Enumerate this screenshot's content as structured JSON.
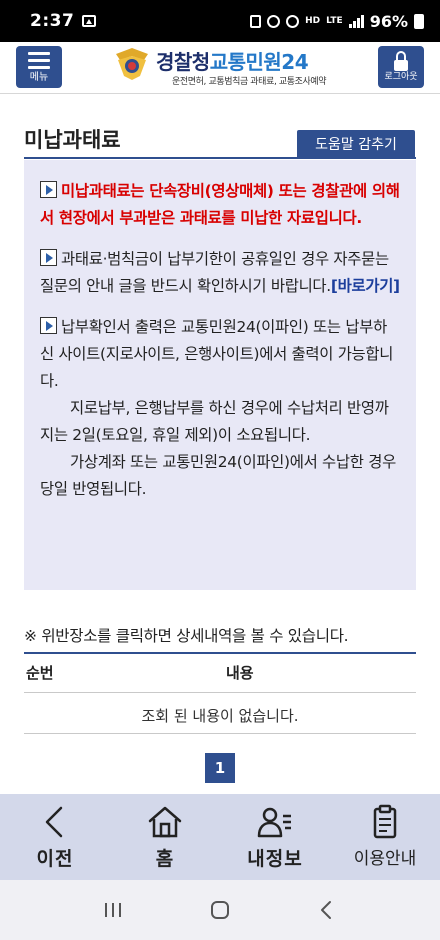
{
  "status_bar": {
    "time": "2:37",
    "network": "HD",
    "lte": "LTE",
    "battery": "96%"
  },
  "header": {
    "menu_label": "메뉴",
    "brand_police": "경찰청",
    "brand_service": "교통민원24",
    "brand_subtitle": "운전면허, 교통범칙금 과태료, 교통조사예약",
    "logout_label": "로그아웃"
  },
  "page": {
    "title": "미납과태료",
    "help_button": "도움말 감추기"
  },
  "notice": {
    "p1": "미납과태료는 단속장비(영상매체) 또는 경찰관에 의해서 현장에서 부과받은 과태료를 미납한 자료입니다.",
    "p2": "과태료·범칙금이 납부기한이 공휴일인 경우 자주묻는질문의 안내 글을 반드시 확인하시기 바랍니다.",
    "p2_link": "[바로가기]",
    "p3": "납부확인서 출력은 교통민원24(이파인) 또는 납부하신 사이트(지로사이트, 은행사이트)에서 출력이 가능합니다.",
    "p3b": "지로납부, 은행납부를 하신 경우에 수납처리 반영까지는 2일(토요일, 휴일 제외)이 소요됩니다.",
    "p3c": "가상계좌 또는 교통민원24(이파인)에서 수납한 경우 당일 반영됩니다."
  },
  "table": {
    "info": "※ 위반장소를 클릭하면 상세내역을 볼 수 있습니다.",
    "col_no": "순번",
    "col_content": "내용",
    "empty": "조회 된 내용이 없습니다."
  },
  "pagination": {
    "current": "1"
  },
  "bottom_nav": {
    "back": "이전",
    "home": "홈",
    "my_info": "내정보",
    "guide": "이용안내"
  },
  "colors": {
    "brand_navy": "#2f4f8f",
    "notice_bg": "#e8e8f6",
    "alert_red": "#d80000",
    "nav_bg": "#d3d8ea"
  }
}
